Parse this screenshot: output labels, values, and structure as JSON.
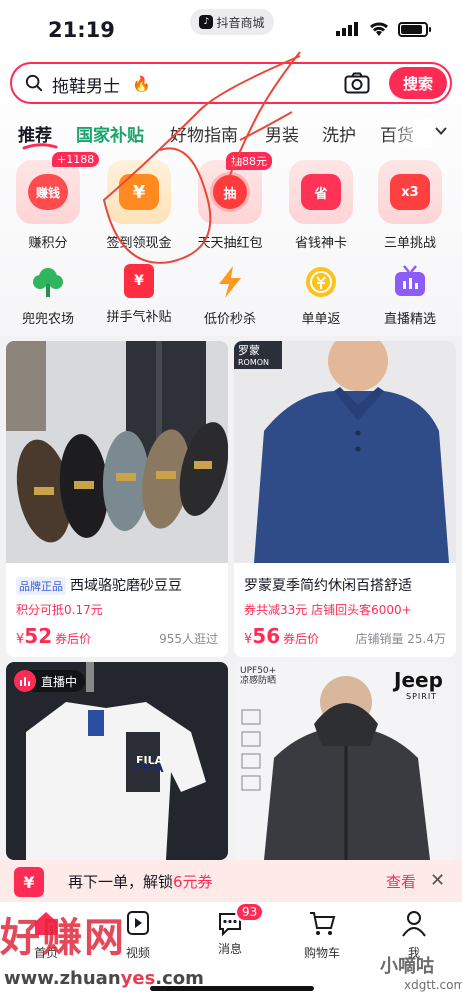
{
  "status_bar": {
    "time": "21:19",
    "app_name": "抖音商城",
    "battery_level": 0.8
  },
  "search": {
    "value": "拖鞋男士",
    "button_label": "搜索"
  },
  "tabs": [
    "推荐",
    "国家补贴",
    "好物指南",
    "男装",
    "洗护",
    "百货"
  ],
  "quick_entries": [
    {
      "label": "赚积分",
      "badge": "+1188",
      "tile_text": "赚钱",
      "color": "#ff4d4f"
    },
    {
      "label": "签到领现金",
      "badge": "",
      "tile_text": "¥",
      "color": "#ff8a1f"
    },
    {
      "label": "天天抽红包",
      "badge": "抽88元",
      "tile_text": "抽",
      "color": "#ff3b3b"
    },
    {
      "label": "省钱神卡",
      "badge": "",
      "tile_text": "省",
      "color": "#ff3355"
    },
    {
      "label": "三单挑战",
      "badge": "",
      "tile_text": "x3",
      "color": "#ff4040"
    }
  ],
  "secondary_entries": [
    {
      "label": "兜兜农场",
      "icon": "tree-icon"
    },
    {
      "label": "拼手气补贴",
      "icon": "red-envelope-icon",
      "glyph": "¥"
    },
    {
      "label": "低价秒杀",
      "icon": "lightning-icon"
    },
    {
      "label": "单单返",
      "icon": "coin-icon"
    },
    {
      "label": "直播精选",
      "icon": "tv-icon"
    }
  ],
  "products": [
    {
      "brand_tag": "品牌正品",
      "title": "西域骆驼磨砂豆豆",
      "sub": "积分可抵0.17元",
      "price": "52",
      "price_label": "券后价",
      "sold": "955人逛过"
    },
    {
      "brand_tag": "",
      "title": "罗蒙夏季简约休闲百搭舒适",
      "sub": "券共减33元  店铺回头客6000+",
      "price": "56",
      "price_label": "券后价",
      "sold": "店铺销量 25.4万",
      "logo_text": "罗蒙",
      "logo_sub": "ROMON"
    },
    {
      "live_label": "直播中",
      "print": "FILA"
    },
    {
      "print": "Jeep",
      "print_sub": "SPIRIT",
      "badge_lines": [
        "UPF50+",
        "凉感防晒"
      ]
    }
  ],
  "coupon_bar": {
    "text_prefix": "再下一单，解锁",
    "highlight": "6元券",
    "action": "查看",
    "icon": "¥"
  },
  "bottom_nav": [
    {
      "label": "首页",
      "icon": "home-icon"
    },
    {
      "label": "视频",
      "icon": "video-icon"
    },
    {
      "label": "消息",
      "icon": "message-icon",
      "badge": "93"
    },
    {
      "label": "购物车",
      "icon": "cart-icon"
    },
    {
      "label": "我",
      "icon": "profile-icon"
    }
  ],
  "watermarks": {
    "main": "好赚网",
    "url_prefix": "www.zhuan",
    "url_accent": "yes",
    "url_suffix": ".com",
    "right": "小嘀咕",
    "right_url": "xdgtt.com"
  }
}
